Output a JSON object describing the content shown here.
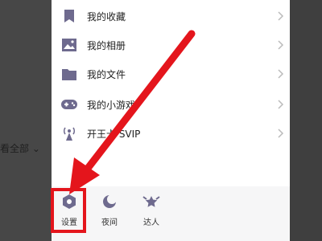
{
  "backdrop": {
    "text": "看全部 ⌄"
  },
  "menu": {
    "items": [
      {
        "label": "我的收藏",
        "icon": "bookmark-icon"
      },
      {
        "label": "我的相册",
        "icon": "photo-album-icon"
      },
      {
        "label": "我的文件",
        "icon": "folder-icon"
      },
      {
        "label": "我的小游戏",
        "icon": "gamepad-icon"
      },
      {
        "label": "开王卡 SVIP",
        "icon": "signal-tower-icon"
      }
    ]
  },
  "bottom_bar": {
    "tabs": [
      {
        "label": "设置",
        "icon": "settings-hexagon-icon"
      },
      {
        "label": "夜间",
        "icon": "moon-icon"
      },
      {
        "label": "达人",
        "icon": "winged-star-icon"
      }
    ]
  },
  "colors": {
    "accent_red": "#e4151c",
    "icon_purple": "#6e6a8e",
    "panel_bg": "#ffffff",
    "backdrop": "#3a3a3a"
  }
}
